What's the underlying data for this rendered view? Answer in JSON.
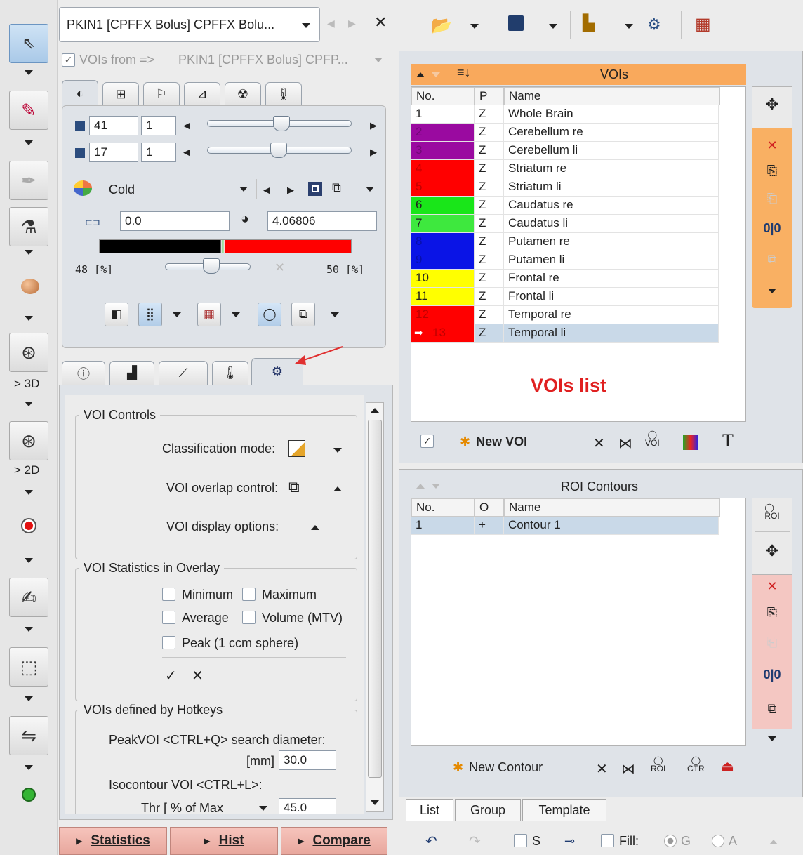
{
  "header": {
    "study_selector": "PKIN1 [CPFFX Bolus] CPFFX Bolu...",
    "vois_from_label": "VOIs from =>",
    "vois_from_value": "PKIN1 [CPFFX Bolus] CPFP...",
    "vois_from_checked": true
  },
  "left_toolbar": {
    "label_3d": "> 3D",
    "label_2d": "> 2D"
  },
  "image_controls": {
    "slice1_value": "41",
    "slice1_step": "1",
    "slice2_value": "17",
    "slice2_step": "1",
    "colormap": "Cold",
    "min_value": "0.0",
    "max_value": "4.06806",
    "lower_pct": "48 [%]",
    "upper_pct": "50 [%]"
  },
  "voi_controls": {
    "section_title": "VOI Controls",
    "classification_label": "Classification mode:",
    "overlap_label": "VOI overlap control:",
    "display_label": "VOI display options:",
    "stats_title": "VOI Statistics in Overlay",
    "stats": [
      "Minimum",
      "Maximum",
      "Average",
      "Volume (MTV)",
      "Peak (1 ccm sphere)"
    ],
    "check_all": "✓",
    "uncheck_all": "✕",
    "hotkeys_title": "VOIs defined by Hotkeys",
    "peak_label": "PeakVOI <CTRL+Q> search diameter:",
    "peak_unit": "[mm]",
    "peak_value": "30.0",
    "iso_label": "Isocontour VOI <CTRL+L>:",
    "thr_label": "Thr [ % of Max",
    "thr_value": "45.0"
  },
  "vois_panel": {
    "header": "VOIs",
    "col_no": "No.",
    "col_p": "P",
    "col_name": "Name",
    "rows": [
      {
        "no": "1",
        "p": "Z",
        "name": "Whole Brain",
        "color": "#ffffff"
      },
      {
        "no": "2",
        "p": "Z",
        "name": "Cerebellum re",
        "color": "#9a0aa0"
      },
      {
        "no": "3",
        "p": "Z",
        "name": "Cerebellum li",
        "color": "#9a0aa0"
      },
      {
        "no": "4",
        "p": "Z",
        "name": "Striatum re",
        "color": "#ff0000"
      },
      {
        "no": "5",
        "p": "Z",
        "name": "Striatum li",
        "color": "#ff0000"
      },
      {
        "no": "6",
        "p": "Z",
        "name": "Caudatus re",
        "color": "#19e619"
      },
      {
        "no": "7",
        "p": "Z",
        "name": "Caudatus li",
        "color": "#3ee83e"
      },
      {
        "no": "8",
        "p": "Z",
        "name": "Putamen re",
        "color": "#0a14e6"
      },
      {
        "no": "9",
        "p": "Z",
        "name": "Putamen li",
        "color": "#0a14e6"
      },
      {
        "no": "10",
        "p": "Z",
        "name": "Frontal re",
        "color": "#ffff00"
      },
      {
        "no": "11",
        "p": "Z",
        "name": "Frontal li",
        "color": "#ffff00"
      },
      {
        "no": "12",
        "p": "Z",
        "name": "Temporal re",
        "color": "#ff0000"
      },
      {
        "no": "13",
        "p": "Z",
        "name": "Temporal li",
        "color": "#ff0000"
      }
    ],
    "annotation": "VOIs list",
    "new_voi": "New VOI",
    "show_checked": true
  },
  "roi_panel": {
    "header": "ROI Contours",
    "col_no": "No.",
    "col_o": "O",
    "col_name": "Name",
    "rows": [
      {
        "no": "1",
        "o": "+",
        "name": "Contour 1"
      }
    ],
    "new_contour": "New Contour"
  },
  "bottom_tabs": [
    "List",
    "Group",
    "Template"
  ],
  "bottom_toolbar": {
    "s_label": "S",
    "fill_label": "Fill:",
    "g_label": "G",
    "a_label": "A"
  },
  "bottom_buttons": {
    "statistics": "Statistics",
    "hist": "Hist",
    "compare": "Compare"
  },
  "colors": {
    "vois_header": "#f9a95c",
    "right_bar_pink": "#f4c7c2",
    "right_bar_orange": "#f9b063",
    "annotation_red": "#e02020"
  }
}
